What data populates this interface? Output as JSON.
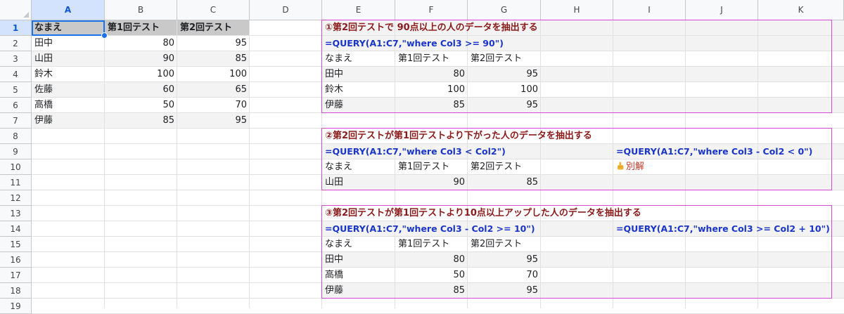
{
  "columns": [
    "A",
    "B",
    "C",
    "D",
    "E",
    "F",
    "G",
    "H",
    "I",
    "J",
    "K"
  ],
  "rows": [
    "1",
    "2",
    "3",
    "4",
    "5",
    "6",
    "7",
    "8",
    "9",
    "10",
    "11",
    "12",
    "13",
    "14",
    "15",
    "16",
    "17",
    "18",
    "19"
  ],
  "source_table": {
    "header": [
      "なまえ",
      "第1回テスト",
      "第2回テスト"
    ],
    "rows": [
      [
        "田中",
        "80",
        "95"
      ],
      [
        "山田",
        "90",
        "85"
      ],
      [
        "鈴木",
        "100",
        "100"
      ],
      [
        "佐藤",
        "60",
        "65"
      ],
      [
        "高橋",
        "50",
        "70"
      ],
      [
        "伊藤",
        "85",
        "95"
      ]
    ]
  },
  "section1": {
    "title": "①第2回テストで 90点以上の人のデータを抽出する",
    "formula": "=QUERY(A1:C7,\"where Col3 >= 90\")",
    "header": [
      "なまえ",
      "第1回テスト",
      "第2回テスト"
    ],
    "rows": [
      [
        "田中",
        "80",
        "95"
      ],
      [
        "鈴木",
        "100",
        "100"
      ],
      [
        "伊藤",
        "85",
        "95"
      ]
    ]
  },
  "section2": {
    "title": "②第2回テストが第1回テストより下がった人のデータを抽出する",
    "formula": "=QUERY(A1:C7,\"where Col3 < Col2\")",
    "alt_formula": "=QUERY(A1:C7,\"where Col3 - Col2 < 0\")",
    "alt_note": "別解",
    "alt_note_icon": "pointing-hand-icon",
    "header": [
      "なまえ",
      "第1回テスト",
      "第2回テスト"
    ],
    "rows": [
      [
        "山田",
        "90",
        "85"
      ]
    ]
  },
  "section3": {
    "title": "③第2回テストが第1回テストより10点以上アップした人のデータを抽出する",
    "formula": "=QUERY(A1:C7,\"where Col3 - Col2 >= 10\")",
    "alt_formula": "=QUERY(A1:C7,\"where Col3 >= Col2 + 10\")",
    "header": [
      "なまえ",
      "第1回テスト",
      "第2回テスト"
    ],
    "rows": [
      [
        "田中",
        "80",
        "95"
      ],
      [
        "高橋",
        "50",
        "70"
      ],
      [
        "伊藤",
        "85",
        "95"
      ]
    ]
  },
  "colors": {
    "title": "#8b1a1a",
    "formula": "#1a35c9",
    "note": "#c0392b",
    "box": "#d44ad8",
    "selection": "#1a73e8"
  }
}
